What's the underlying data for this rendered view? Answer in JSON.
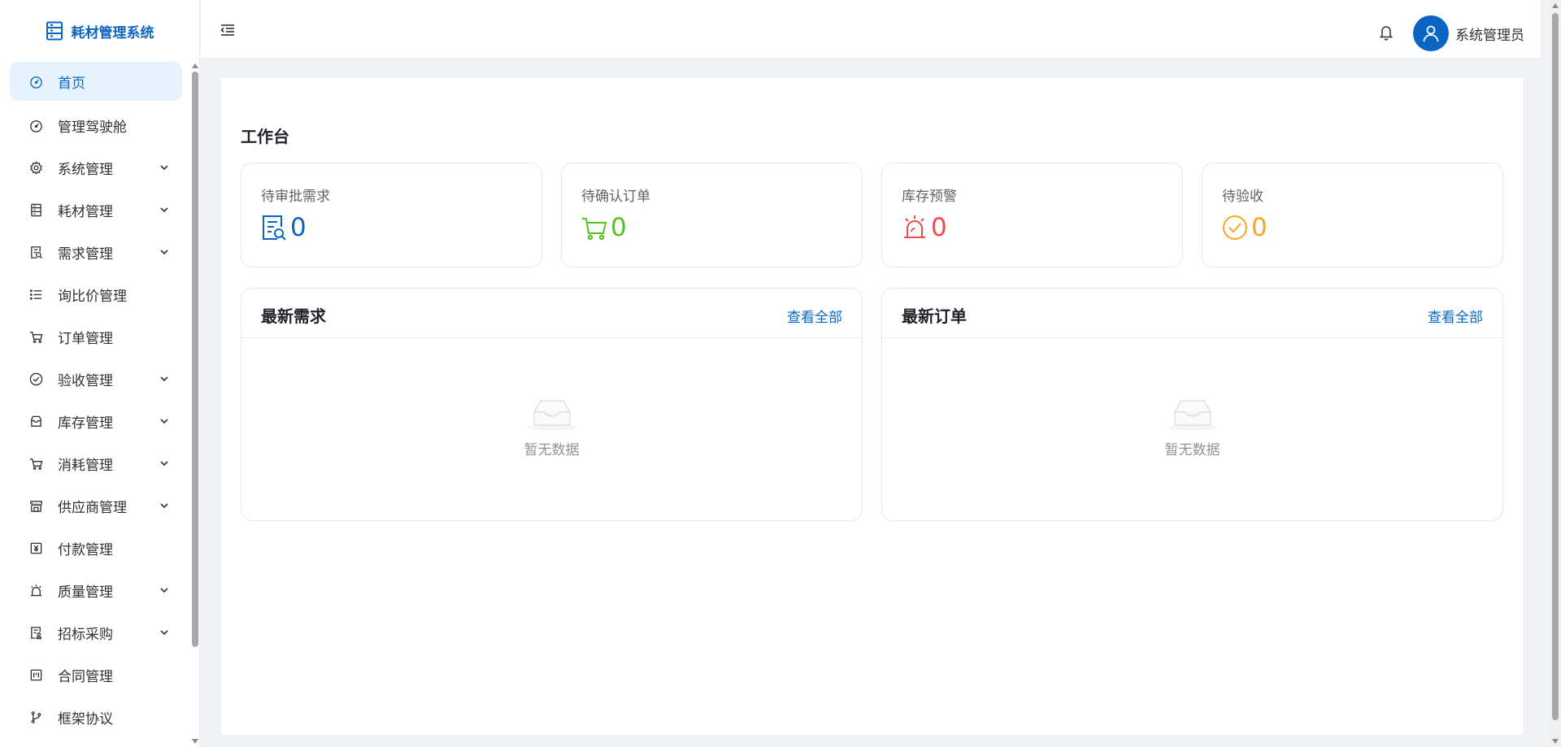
{
  "brand": {
    "title": "耗材管理系统",
    "icon": "document-icon"
  },
  "sidebar": {
    "items": [
      {
        "label": "首页",
        "icon": "dashboard-icon",
        "active": true,
        "expandable": false
      },
      {
        "label": "管理驾驶舱",
        "icon": "dashboard-icon",
        "active": false,
        "expandable": false
      },
      {
        "label": "系统管理",
        "icon": "gear-icon",
        "active": false,
        "expandable": true
      },
      {
        "label": "耗材管理",
        "icon": "document-icon",
        "active": false,
        "expandable": true
      },
      {
        "label": "需求管理",
        "icon": "search-doc-icon",
        "active": false,
        "expandable": true
      },
      {
        "label": "询比价管理",
        "icon": "list-icon",
        "active": false,
        "expandable": false
      },
      {
        "label": "订单管理",
        "icon": "cart-icon",
        "active": false,
        "expandable": false
      },
      {
        "label": "验收管理",
        "icon": "check-circle-icon",
        "active": false,
        "expandable": true
      },
      {
        "label": "库存管理",
        "icon": "box-icon",
        "active": false,
        "expandable": true
      },
      {
        "label": "消耗管理",
        "icon": "cart-icon",
        "active": false,
        "expandable": true
      },
      {
        "label": "供应商管理",
        "icon": "shop-icon",
        "active": false,
        "expandable": true
      },
      {
        "label": "付款管理",
        "icon": "payment-icon",
        "active": false,
        "expandable": false
      },
      {
        "label": "质量管理",
        "icon": "alarm-icon",
        "active": false,
        "expandable": true
      },
      {
        "label": "招标采购",
        "icon": "stamp-doc-icon",
        "active": false,
        "expandable": true
      },
      {
        "label": "合同管理",
        "icon": "contract-icon",
        "active": false,
        "expandable": false
      },
      {
        "label": "框架协议",
        "icon": "branch-icon",
        "active": false,
        "expandable": false
      }
    ]
  },
  "header": {
    "collapse_icon": "collapse-menu-icon",
    "bell_icon": "bell-icon",
    "user_name": "系统管理员",
    "avatar_icon": "user-icon"
  },
  "main": {
    "title": "工作台",
    "stats": [
      {
        "label": "待审批需求",
        "value": "0",
        "icon": "search-doc-icon",
        "color": "#0a66c2"
      },
      {
        "label": "待确认订单",
        "value": "0",
        "icon": "cart-icon",
        "color": "#52c41a"
      },
      {
        "label": "库存预警",
        "value": "0",
        "icon": "alarm-icon",
        "color": "#f5484d"
      },
      {
        "label": "待验收",
        "value": "0",
        "icon": "check-circle-icon",
        "color": "#f5a623"
      }
    ],
    "cards": [
      {
        "title": "最新需求",
        "view_all": "查看全部",
        "empty_text": "暂无数据"
      },
      {
        "title": "最新订单",
        "view_all": "查看全部",
        "empty_text": "暂无数据"
      }
    ]
  },
  "colors": {
    "primary": "#0a66c2",
    "active_bg": "#e6f2fd"
  }
}
